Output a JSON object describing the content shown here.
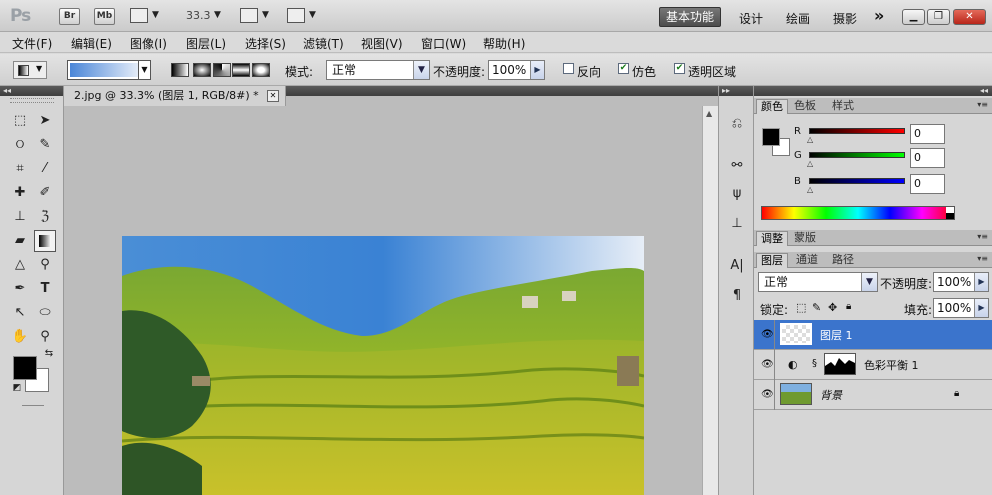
{
  "appbar": {
    "logo": "Ps",
    "bridge": "Br",
    "minibridge": "Mb",
    "zoom": "33.3",
    "workspaces": [
      "基本功能",
      "设计",
      "绘画",
      "摄影"
    ],
    "more": "»"
  },
  "menu": [
    "文件(F)",
    "编辑(E)",
    "图像(I)",
    "图层(L)",
    "选择(S)",
    "滤镜(T)",
    "视图(V)",
    "窗口(W)",
    "帮助(H)"
  ],
  "options": {
    "mode_label": "模式:",
    "mode_value": "正常",
    "opacity_label": "不透明度:",
    "opacity_value": "100%",
    "reverse_label": "反向",
    "dither_label": "仿色",
    "transparency_label": "透明区域",
    "reverse_checked": false,
    "dither_checked": true,
    "transparency_checked": true
  },
  "document": {
    "tab_title": "2.jpg @ 33.3% (图层 1, RGB/8#) *"
  },
  "color_panel": {
    "tabs": [
      "颜色",
      "色板",
      "样式"
    ],
    "r_label": "R",
    "r_value": "0",
    "g_label": "G",
    "g_value": "0",
    "b_label": "B",
    "b_value": "0"
  },
  "adjust_tabs": [
    "调整",
    "蒙版"
  ],
  "layers_panel": {
    "tabs": [
      "图层",
      "通道",
      "路径"
    ],
    "blend_mode": "正常",
    "opacity_label": "不透明度:",
    "opacity_value": "100%",
    "lock_label": "锁定:",
    "fill_label": "填充:",
    "fill_value": "100%",
    "layers": [
      {
        "name": "图层 1",
        "selected": true
      },
      {
        "name": "色彩平衡 1",
        "selected": false
      },
      {
        "name": "背景",
        "selected": false
      }
    ]
  }
}
